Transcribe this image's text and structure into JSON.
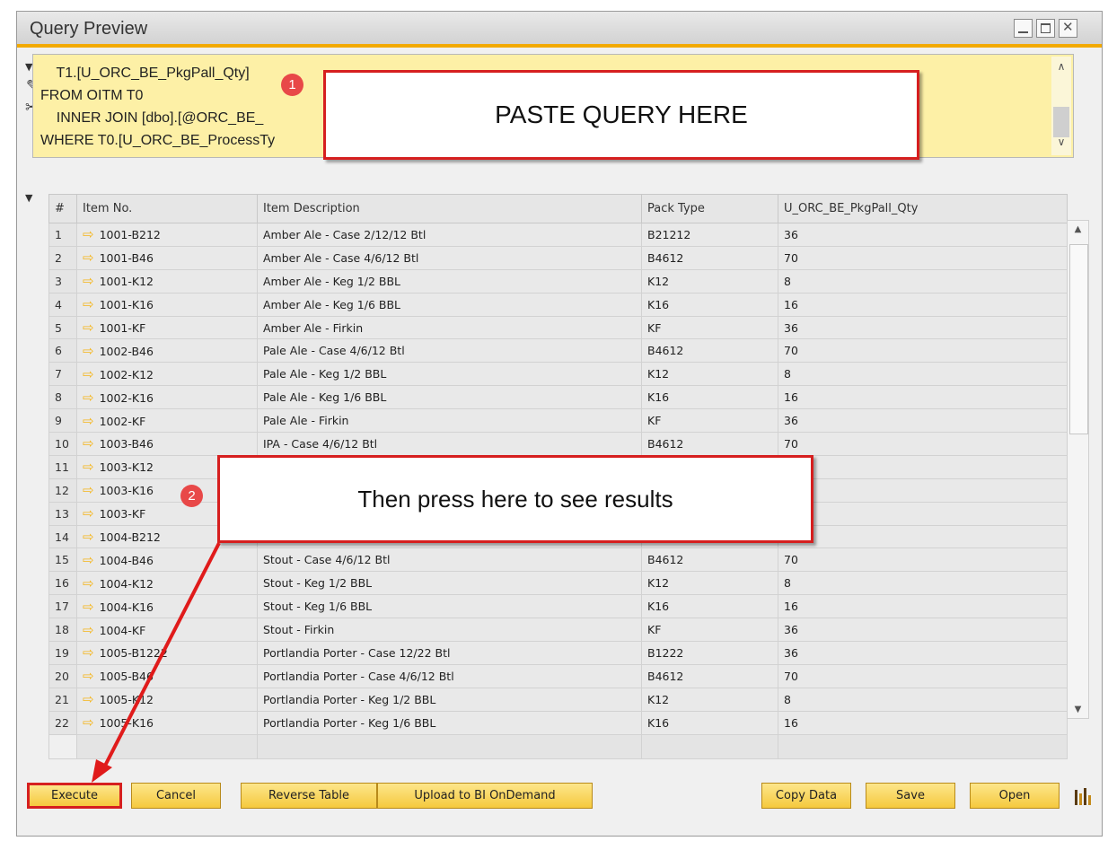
{
  "window": {
    "title": "Query Preview"
  },
  "query_lines": [
    "    T1.[U_ORC_BE_PkgPall_Qty]",
    "FROM OITM T0",
    "    INNER JOIN [dbo].[@ORC_BE_",
    "WHERE T0.[U_ORC_BE_ProcessTy"
  ],
  "callouts": {
    "paste": {
      "badge": "1",
      "text": "PASTE QUERY HERE"
    },
    "press": {
      "badge": "2",
      "text": "Then press here to see results"
    }
  },
  "grid": {
    "columns": [
      "#",
      "Item No.",
      "Item Description",
      "Pack Type",
      "U_ORC_BE_PkgPall_Qty"
    ],
    "rows": [
      [
        "1",
        "1001-B212",
        "Amber Ale - Case 2/12/12 Btl",
        "B21212",
        "36"
      ],
      [
        "2",
        "1001-B46",
        "Amber Ale - Case 4/6/12 Btl",
        "B4612",
        "70"
      ],
      [
        "3",
        "1001-K12",
        "Amber Ale - Keg 1/2 BBL",
        "K12",
        "8"
      ],
      [
        "4",
        "1001-K16",
        "Amber Ale - Keg 1/6 BBL",
        "K16",
        "16"
      ],
      [
        "5",
        "1001-KF",
        "Amber Ale - Firkin",
        "KF",
        "36"
      ],
      [
        "6",
        "1002-B46",
        "Pale Ale - Case 4/6/12 Btl",
        "B4612",
        "70"
      ],
      [
        "7",
        "1002-K12",
        "Pale Ale - Keg 1/2 BBL",
        "K12",
        "8"
      ],
      [
        "8",
        "1002-K16",
        "Pale Ale - Keg 1/6 BBL",
        "K16",
        "16"
      ],
      [
        "9",
        "1002-KF",
        "Pale Ale - Firkin",
        "KF",
        "36"
      ],
      [
        "10",
        "1003-B46",
        "IPA - Case 4/6/12 Btl",
        "B4612",
        "70"
      ],
      [
        "11",
        "1003-K12",
        "",
        "",
        ""
      ],
      [
        "12",
        "1003-K16",
        "",
        "",
        ""
      ],
      [
        "13",
        "1003-KF",
        "",
        "",
        ""
      ],
      [
        "14",
        "1004-B212",
        "",
        "",
        ""
      ],
      [
        "15",
        "1004-B46",
        "Stout - Case 4/6/12 Btl",
        "B4612",
        "70"
      ],
      [
        "16",
        "1004-K12",
        "Stout - Keg 1/2 BBL",
        "K12",
        "8"
      ],
      [
        "17",
        "1004-K16",
        "Stout - Keg 1/6 BBL",
        "K16",
        "16"
      ],
      [
        "18",
        "1004-KF",
        "Stout - Firkin",
        "KF",
        "36"
      ],
      [
        "19",
        "1005-B1222",
        "Portlandia Porter - Case 12/22 Btl",
        "B1222",
        "36"
      ],
      [
        "20",
        "1005-B46",
        "Portlandia Porter - Case 4/6/12 Btl",
        "B4612",
        "70"
      ],
      [
        "21",
        "1005-K12",
        "Portlandia Porter - Keg 1/2 BBL",
        "K12",
        "8"
      ],
      [
        "22",
        "1005-K16",
        "Portlandia Porter - Keg 1/6 BBL",
        "K16",
        "16"
      ]
    ]
  },
  "buttons": {
    "execute": "Execute",
    "cancel": "Cancel",
    "reverse_table": "Reverse Table",
    "upload_bi": "Upload to BI OnDemand",
    "copy_data": "Copy Data",
    "save": "Save",
    "open": "Open"
  },
  "icons": {
    "collapse_query": "triangle-down-icon",
    "edit": "pencil-icon",
    "clear": "scissors-icon",
    "collapse_grid": "triangle-down-icon",
    "row_link": "orange-arrow-icon",
    "chart": "bar-chart-icon"
  },
  "colors": {
    "accent": "#f2a900",
    "query_bg": "#fdf0a6",
    "callout_border": "#d61f1f",
    "badge": "#e84848",
    "button": "#f5c93e"
  }
}
